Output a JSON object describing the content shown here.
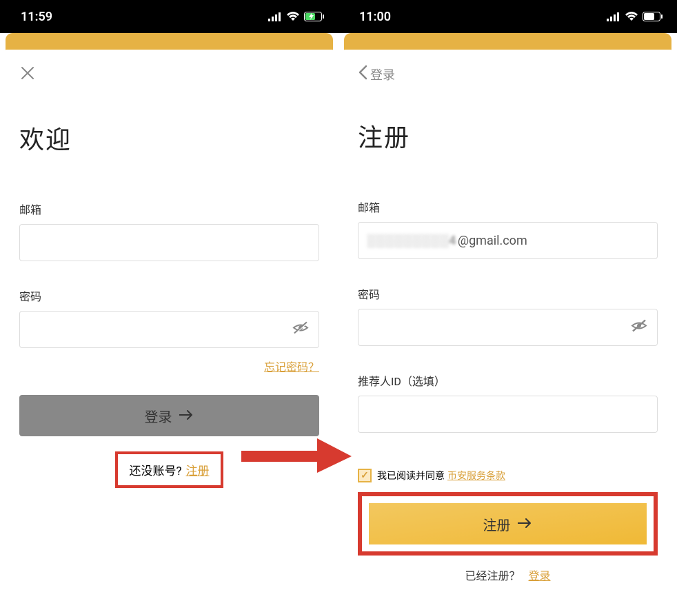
{
  "colors": {
    "accent_gold": "#e6b244",
    "link_gold": "#d9a03a",
    "highlight_red": "#d73a2f",
    "disabled_gray": "#888888"
  },
  "icons": {
    "close": "close-icon",
    "back": "chevron-left-icon",
    "eye_off": "eye-off-icon",
    "arrow_right": "arrow-right-icon",
    "signal": "cellular-signal-icon",
    "wifi": "wifi-icon",
    "battery_charging": "battery-charging-icon",
    "battery": "battery-icon",
    "check": "check-icon"
  },
  "left": {
    "status_time": "11:59",
    "title": "欢迎",
    "email_label": "邮箱",
    "email_value": "",
    "password_label": "密码",
    "password_value": "",
    "forgot_password": "忘记密码？",
    "login_button": "登录",
    "no_account_text": "还没账号?",
    "signup_link": "注册"
  },
  "right": {
    "status_time": "11:00",
    "back_label": "登录",
    "title": "注册",
    "email_label": "邮箱",
    "email_value_blurred": "░░░░░░░░░4",
    "email_value_suffix": "@gmail.com",
    "password_label": "密码",
    "password_value": "",
    "referral_label": "推荐人ID（选填）",
    "referral_value": "",
    "terms_checked": true,
    "terms_text": "我已阅读并同意",
    "terms_link": "币安服务条款",
    "register_button": "注册",
    "already_registered_text": "已经注册？",
    "login_link": "登录"
  }
}
